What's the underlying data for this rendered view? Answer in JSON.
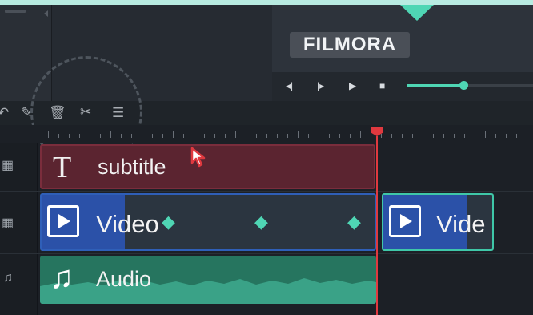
{
  "preview": {
    "brand": "FILMORA",
    "controls": {
      "prev_frame": "◂|",
      "next_frame": "|▸",
      "play": "▶",
      "stop": "■"
    },
    "volume": 0.45
  },
  "toolbar": {
    "tools": [
      {
        "name": "undo-icon",
        "glyph": "↶"
      },
      {
        "name": "edit-icon",
        "glyph": "✎"
      },
      {
        "name": "delete-icon",
        "glyph": "🗑"
      },
      {
        "name": "cut-icon",
        "glyph": "✂"
      },
      {
        "name": "adjust-icon",
        "glyph": "☰"
      }
    ]
  },
  "tracks": {
    "subtitle": {
      "label": "subtitle",
      "icon": "film-icon"
    },
    "video": {
      "label": "Video",
      "label2": "Vide",
      "icon": "film-icon"
    },
    "audio": {
      "label": "Audio",
      "icon": "music-note-icon"
    }
  },
  "colors": {
    "accent": "#4fd6b4",
    "playhead": "#e0393f",
    "subtitle_clip": "#5b2430",
    "video_clip": "#2b51a8",
    "audio_clip": "#26755f"
  }
}
